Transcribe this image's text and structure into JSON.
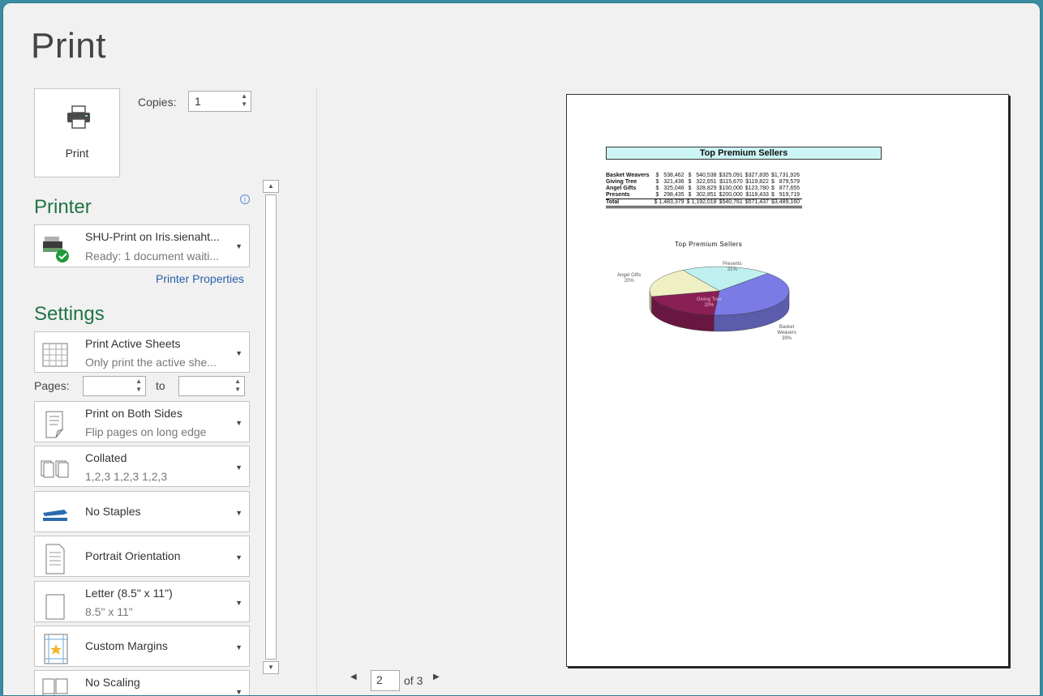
{
  "title": "Print",
  "print_button": {
    "label": "Print"
  },
  "copies": {
    "label": "Copies:",
    "value": "1"
  },
  "printer": {
    "section_title": "Printer",
    "name": "SHU-Print on Iris.sienaht...",
    "status": "Ready: 1 document waiti...",
    "properties_link": "Printer Properties"
  },
  "settings": {
    "section_title": "Settings",
    "what_to_print": {
      "title": "Print Active Sheets",
      "subtitle": "Only print the active she..."
    },
    "pages": {
      "label": "Pages:",
      "from": "",
      "to_label": "to",
      "to": ""
    },
    "sides": {
      "title": "Print on Both Sides",
      "subtitle": "Flip pages on long edge"
    },
    "collation": {
      "title": "Collated",
      "subtitle": "1,2,3   1,2,3   1,2,3"
    },
    "staples": {
      "title": "No Staples"
    },
    "orientation": {
      "title": "Portrait Orientation"
    },
    "paper": {
      "title": "Letter (8.5\" x 11\")",
      "subtitle": "8.5\" x 11\""
    },
    "margins": {
      "title": "Custom Margins"
    },
    "scaling": {
      "title": "No Scaling"
    }
  },
  "preview": {
    "current_page": "2",
    "of_label": "of 3",
    "sheet_title": "Top Premium Sellers",
    "rows": [
      {
        "name": "Basket Weavers",
        "c1": "$   538,462",
        "c2": "$   540,538",
        "c3": "$325,091",
        "c4": "$327,835",
        "c5": "$1,731,926"
      },
      {
        "name": "Giving Tree",
        "c1": "$   321,436",
        "c2": "$   322,651",
        "c3": "$115,670",
        "c4": "$119,822",
        "c5": "$   879,579"
      },
      {
        "name": "Angel Gifts",
        "c1": "$   325,046",
        "c2": "$   328,829",
        "c3": "$100,000",
        "c4": "$123,780",
        "c5": "$   877,655"
      },
      {
        "name": "Presents",
        "c1": "$   298,435",
        "c2": "$   302,851",
        "c3": "$200,000",
        "c4": "$118,433",
        "c5": "$   919,719"
      }
    ],
    "total": {
      "name": "Total",
      "c1": "$ 1,483,379",
      "c2": "$ 1,192,018",
      "c3": "$540,761",
      "c4": "$571,437",
      "c5": "$3,489,160"
    },
    "pie": {
      "title": "Top Premium Sellers",
      "slices": [
        {
          "label": "Presents",
          "pct": "21%",
          "value": 21,
          "color": "#bff0f0"
        },
        {
          "label": "Basket Weavers",
          "pct": "39%",
          "value": 39,
          "color": "#7b7be6"
        },
        {
          "label": "Giving Tree",
          "pct": "20%",
          "value": 20,
          "color": "#8a1f55"
        },
        {
          "label": "Angel Gifts",
          "pct": "20%",
          "value": 20,
          "color": "#efefc4"
        }
      ]
    }
  },
  "colors": {
    "accent": "#217346",
    "link": "#2a5fa8",
    "frame": "#3a8ca0"
  }
}
